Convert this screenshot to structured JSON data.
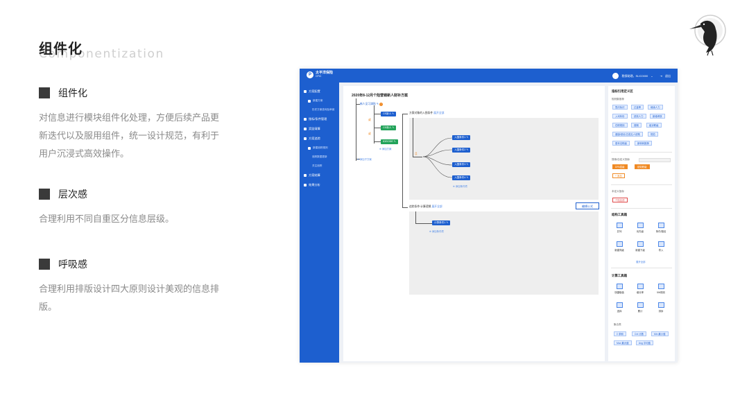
{
  "heading": {
    "title_cn": "组件化",
    "title_en": "Componentization"
  },
  "sections": [
    {
      "title": "组件化",
      "body": "对信息进行模块组件化处理，方便后续产品更新迭代以及服用组件，统一设计规范，有利于用户沉浸式高效操作。"
    },
    {
      "title": "层次感",
      "body": "合理利用不同自重区分信息层级。"
    },
    {
      "title": "呼吸感",
      "body": "合理利用排版设计四大原则设计美观的信息排版。"
    }
  ],
  "app": {
    "brand": {
      "name": "太平洋保险",
      "sub": "CPIC",
      "mark": "P"
    },
    "user": {
      "name": "税保助理，SLIC0000",
      "logout": "退出"
    },
    "nav": [
      {
        "label": "方案配置",
        "level": 0
      },
      {
        "label": "新建方案",
        "level": 1
      },
      {
        "label": "历史方案查询及审阅",
        "level": 2
      },
      {
        "label": "指标/条件管理",
        "level": 0
      },
      {
        "label": "奖励清算",
        "level": 0
      },
      {
        "label": "方案追踪",
        "level": 0
      },
      {
        "label": "新建追踪规则",
        "level": 1
      },
      {
        "label": "追踪数据更新",
        "level": 2
      },
      {
        "label": "关注追踪",
        "level": 2
      },
      {
        "label": "方案结算",
        "level": 0
      },
      {
        "label": "效果分析",
        "level": 0
      }
    ],
    "main": {
      "title": "2020年8-12月个险营销新人财补方案",
      "root_label": "新人见习津贴",
      "children": [
        "CE新人",
        "CD新人",
        "IDE/ODE"
      ],
      "add_plan": "添加方案",
      "add_sub_plan": "添加子方案",
      "branch_a": "方案对象的入围条件",
      "branch_a_link": "展开全部",
      "conditions": [
        "入围条件1",
        "入围条件2",
        "入围条件3",
        "入围条件4"
      ],
      "add_condition": "添加条件项",
      "branch_b": "追踪条件/计算逻辑",
      "branch_b_link": "展开全部",
      "calc_item": "计算条件1",
      "formula_btn": "编辑公式",
      "or_label": "或",
      "and_label": "且"
    },
    "right": {
      "title": "指标引用定义区",
      "recommend": "规则集推荐",
      "tags": [
        "签约标识",
        "达量率",
        "继续人力",
        "入司年份",
        "绩效人力",
        "新增考核",
        "在职规则",
        "首期",
        "组训职级",
        "健康/绩优/达成见人绩策",
        "规范",
        "基本法职级",
        "新转转推荐"
      ],
      "search_label": "搜索/自定义指标",
      "search_tags": [
        "DPA层级",
        "绩效职级"
      ],
      "add_tag": "+ 添加",
      "custom_label": "本定义指标",
      "custom_tag": "个险业绩",
      "struct_title": "结构工具箱",
      "struct_tools": [
        "并列",
        "优先级",
        "条件/路径",
        "新建同级",
        "新建下级",
        "导入"
      ],
      "more": "展开全部",
      "calc_title": "计算工具箱",
      "calc_tools": [
        "快捷取值",
        "增长率",
        "5W规则",
        "选择",
        "累计",
        "排序"
      ],
      "agg_label": "聚合类",
      "agg_tags": [
        "Σ 求和",
        "Cnt 计数",
        "Min 最小值",
        "Max 最大值",
        "Avg 平均值"
      ]
    }
  }
}
